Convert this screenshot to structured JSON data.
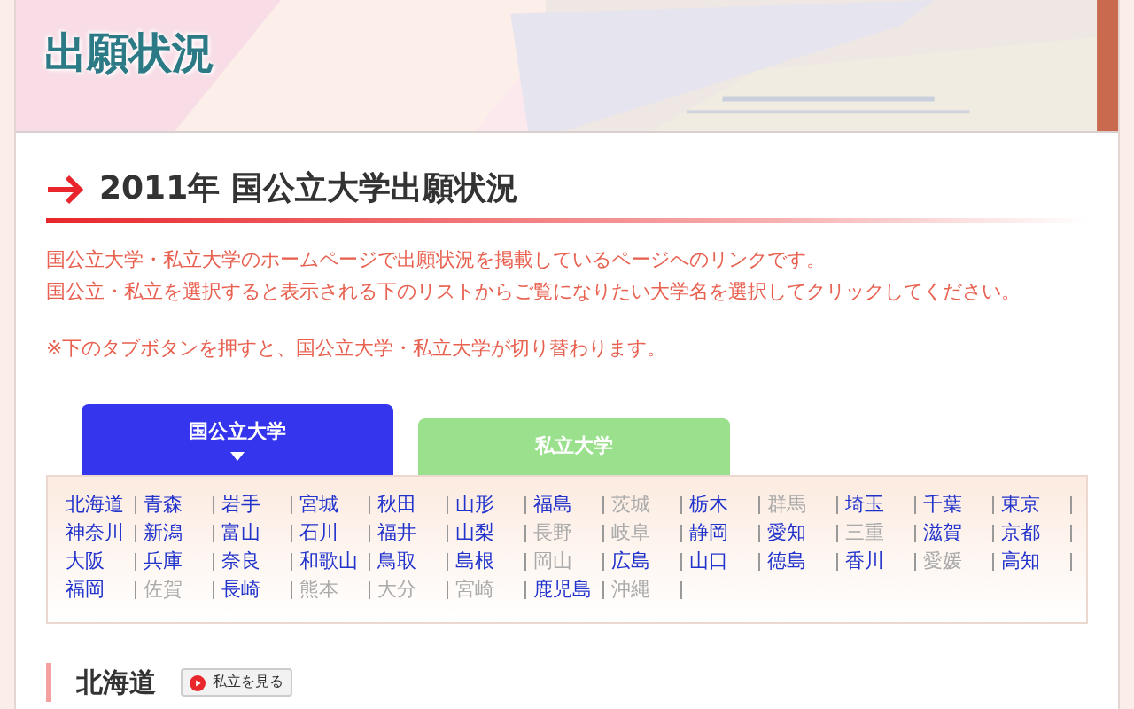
{
  "header": {
    "title": "出願状況",
    "kind": "picture"
  },
  "heading": "2011年 国公立大学出願状況",
  "intro": [
    "国公立大学・私立大学のホームページで出願状況を掲載しているページへのリンクです。",
    "国公立・私立を選択すると表示される下のリストからご覧になりたい大学名を選択してクリックしてください。"
  ],
  "note": "※下のタブボタンを押すと、国公立大学・私立大学が切り替わります。",
  "tabs": [
    {
      "label": "国公立大学",
      "selected": true
    },
    {
      "label": "私立大学",
      "selected": false
    }
  ],
  "prefectures": [
    {
      "name": "北海道",
      "disabled": false
    },
    {
      "name": "青森",
      "disabled": false
    },
    {
      "name": "岩手",
      "disabled": false
    },
    {
      "name": "宮城",
      "disabled": false
    },
    {
      "name": "秋田",
      "disabled": false
    },
    {
      "name": "山形",
      "disabled": false
    },
    {
      "name": "福島",
      "disabled": false
    },
    {
      "name": "茨城",
      "disabled": true
    },
    {
      "name": "栃木",
      "disabled": false
    },
    {
      "name": "群馬",
      "disabled": true
    },
    {
      "name": "埼玉",
      "disabled": false
    },
    {
      "name": "千葉",
      "disabled": false
    },
    {
      "name": "東京",
      "disabled": false
    },
    {
      "name": "神奈川",
      "disabled": false
    },
    {
      "name": "新潟",
      "disabled": false
    },
    {
      "name": "富山",
      "disabled": false
    },
    {
      "name": "石川",
      "disabled": false
    },
    {
      "name": "福井",
      "disabled": false
    },
    {
      "name": "山梨",
      "disabled": false
    },
    {
      "name": "長野",
      "disabled": true
    },
    {
      "name": "岐阜",
      "disabled": true
    },
    {
      "name": "静岡",
      "disabled": false
    },
    {
      "name": "愛知",
      "disabled": false
    },
    {
      "name": "三重",
      "disabled": true
    },
    {
      "name": "滋賀",
      "disabled": false
    },
    {
      "name": "京都",
      "disabled": false
    },
    {
      "name": "大阪",
      "disabled": false
    },
    {
      "name": "兵庫",
      "disabled": false
    },
    {
      "name": "奈良",
      "disabled": false
    },
    {
      "name": "和歌山",
      "disabled": false
    },
    {
      "name": "鳥取",
      "disabled": false
    },
    {
      "name": "島根",
      "disabled": false
    },
    {
      "name": "岡山",
      "disabled": true
    },
    {
      "name": "広島",
      "disabled": false
    },
    {
      "name": "山口",
      "disabled": false
    },
    {
      "name": "徳島",
      "disabled": false
    },
    {
      "name": "香川",
      "disabled": false
    },
    {
      "name": "愛媛",
      "disabled": true
    },
    {
      "name": "高知",
      "disabled": false
    },
    {
      "name": "福岡",
      "disabled": false
    },
    {
      "name": "佐賀",
      "disabled": true
    },
    {
      "name": "長崎",
      "disabled": false
    },
    {
      "name": "熊本",
      "disabled": true
    },
    {
      "name": "大分",
      "disabled": true
    },
    {
      "name": "宮崎",
      "disabled": true
    },
    {
      "name": "鹿児島",
      "disabled": false
    },
    {
      "name": "沖縄",
      "disabled": true
    }
  ],
  "section": {
    "title": "北海道",
    "button": "私立を見る"
  }
}
